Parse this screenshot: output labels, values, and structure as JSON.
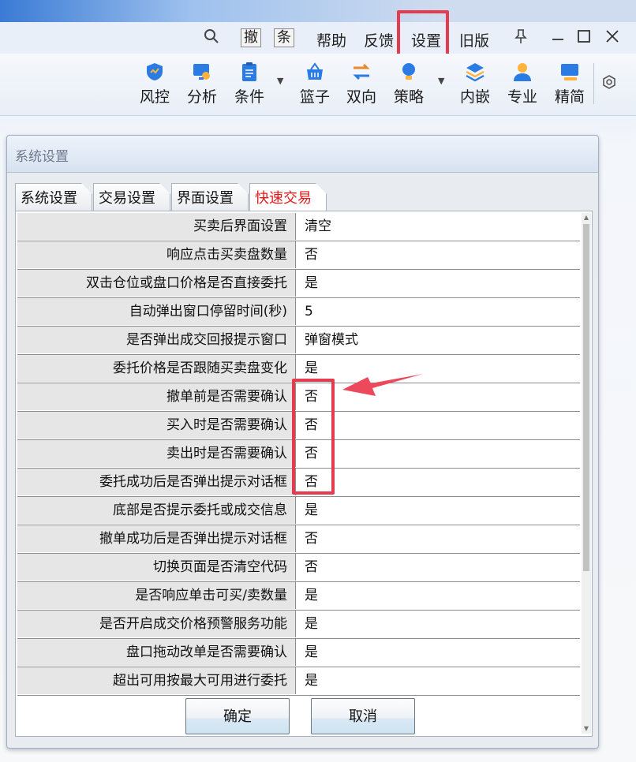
{
  "titlebar": {
    "menu": [
      "帮助",
      "反馈",
      "设置",
      "旧版"
    ],
    "boxed": [
      "撤",
      "条"
    ]
  },
  "toolbar": {
    "buttons": [
      {
        "label": "风控",
        "icon": "shield-icon",
        "color": "#2a7be4"
      },
      {
        "label": "分析",
        "icon": "analysis-icon",
        "color": "#2a7be4"
      },
      {
        "label": "条件",
        "icon": "clipboard-icon",
        "color": "#2a7be4"
      },
      {
        "label": "篮子",
        "icon": "basket-icon",
        "color": "#2a7be4"
      },
      {
        "label": "双向",
        "icon": "exchange-icon",
        "color": "#e8892d"
      },
      {
        "label": "策略",
        "icon": "bulb-icon",
        "color": "#2a7be4"
      },
      {
        "label": "内嵌",
        "icon": "layers-icon",
        "color": "#2a7be4"
      },
      {
        "label": "专业",
        "icon": "user-icon",
        "color": "#2a7be4"
      },
      {
        "label": "精简",
        "icon": "monitor-icon",
        "color": "#2a7be4"
      }
    ]
  },
  "dialog": {
    "title": "系统设置",
    "tabs": [
      "系统设置",
      "交易设置",
      "界面设置",
      "快速交易"
    ],
    "rows": [
      {
        "k": "买卖后界面设置",
        "v": "清空"
      },
      {
        "k": "响应点击买卖盘数量",
        "v": "否"
      },
      {
        "k": "双击仓位或盘口价格是否直接委托",
        "v": "是"
      },
      {
        "k": "自动弹出窗口停留时间(秒)",
        "v": "5"
      },
      {
        "k": "是否弹出成交回报提示窗口",
        "v": "弹窗模式"
      },
      {
        "k": "委托价格是否跟随买卖盘变化",
        "v": "是"
      },
      {
        "k": "撤单前是否需要确认",
        "v": "否"
      },
      {
        "k": "买入时是否需要确认",
        "v": "否"
      },
      {
        "k": "卖出时是否需要确认",
        "v": "否"
      },
      {
        "k": "委托成功后是否弹出提示对话框",
        "v": "否"
      },
      {
        "k": "底部是否提示委托或成交信息",
        "v": "是"
      },
      {
        "k": "撤单成功后是否弹出提示对话框",
        "v": "否"
      },
      {
        "k": "切换页面是否清空代码",
        "v": "否"
      },
      {
        "k": "是否响应单击可买/卖数量",
        "v": "是"
      },
      {
        "k": "是否开启成交价格预警服务功能",
        "v": "是"
      },
      {
        "k": "盘口拖动改单是否需要确认",
        "v": "是"
      },
      {
        "k": "超出可用按最大可用进行委托",
        "v": "是"
      }
    ],
    "ok": "确定",
    "cancel": "取消"
  }
}
